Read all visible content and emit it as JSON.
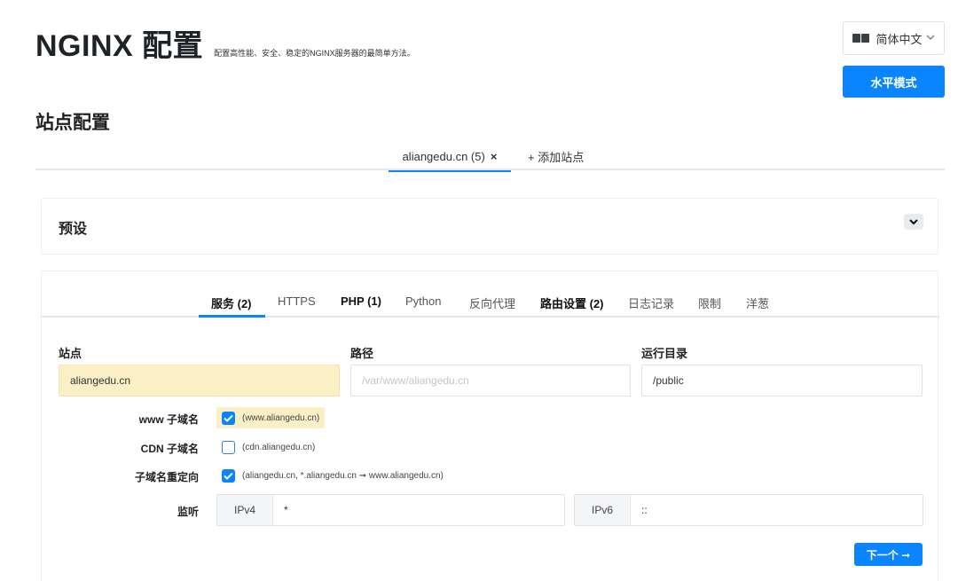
{
  "header": {
    "brand": "NGINX 配置",
    "subtitle": "配置高性能、安全、稳定的NGINX服务器的最简单方法。"
  },
  "language": {
    "label": "简体中文",
    "icon": "translate-icon"
  },
  "mode_button": "水平模式",
  "section_title": "站点配置",
  "site_tabs": {
    "active": {
      "label": "aliangedu.cn (5)",
      "close": "×"
    },
    "add": "+ 添加站点"
  },
  "preset": {
    "title": "预设",
    "toggle": "⌄"
  },
  "server_tabs": [
    {
      "label": "服务 (2)"
    },
    {
      "label": "HTTPS"
    },
    {
      "label": "PHP (1)"
    },
    {
      "label": "Python"
    },
    {
      "label": "反向代理"
    },
    {
      "label": "路由设置 (2)"
    },
    {
      "label": "日志记录"
    },
    {
      "label": "限制"
    },
    {
      "label": "洋葱"
    }
  ],
  "fields": {
    "site": {
      "label": "站点",
      "value": "aliangedu.cn"
    },
    "path": {
      "label": "路径",
      "placeholder": "/var/www/aliangedu.cn"
    },
    "root": {
      "label": "运行目录",
      "value": "/public"
    }
  },
  "options": {
    "www": {
      "label": "www 子域名",
      "checked": true,
      "hint": "(www.aliangedu.cn)"
    },
    "cdn": {
      "label": "CDN 子域名",
      "checked": false,
      "hint": "(cdn.aliangedu.cn)"
    },
    "redirect": {
      "label": "子域名重定向",
      "checked": true,
      "hint": "(aliangedu.cn, *.aliangedu.cn ➞ www.aliangedu.cn)"
    }
  },
  "listen": {
    "label": "监听",
    "ipv4": {
      "label": "IPv4",
      "value": "*"
    },
    "ipv6": {
      "label": "IPv6",
      "value": "::"
    }
  },
  "next_button": "下一个 ➞",
  "colors": {
    "accent": "#0a84ff",
    "highlight": "#fbefc6"
  }
}
